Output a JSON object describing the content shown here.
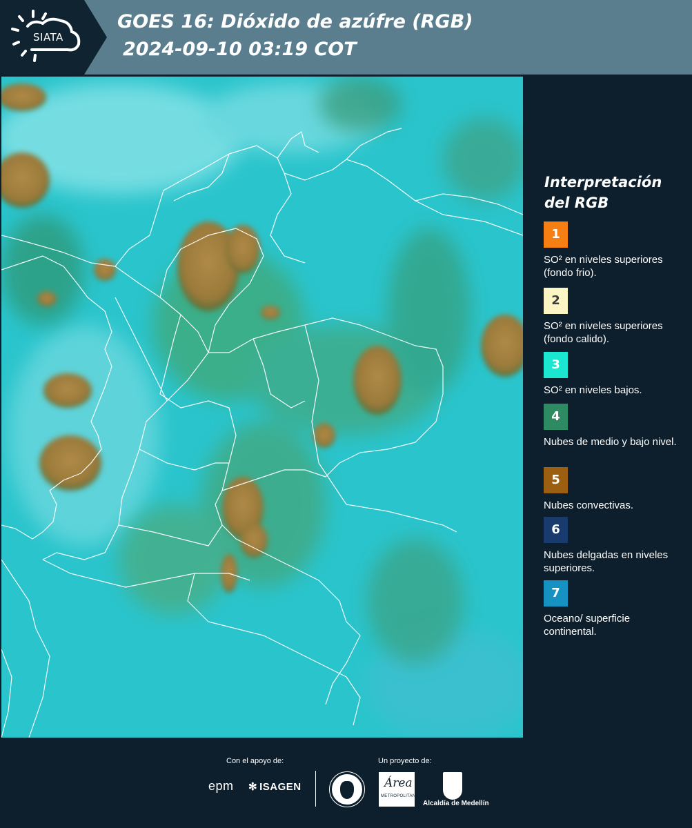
{
  "header": {
    "logo_text": "SIATA",
    "title_line1": "GOES 16: Dióxido de azúfre (RGB)",
    "title_line2": "2024-09-10 03:19 COT"
  },
  "legend": {
    "title_line1": "Interpretación",
    "title_line2": "del RGB",
    "items": [
      {
        "number": "1",
        "color": "#f57f12",
        "text_color": "#ffffff",
        "label": "SO² en niveles superiores (fondo frio)."
      },
      {
        "number": "2",
        "color": "#fbf4c3",
        "text_color": "#3b3b3b",
        "label": "SO² en niveles superiores (fondo calido)."
      },
      {
        "number": "3",
        "color": "#1be7d0",
        "text_color": "#ffffff",
        "label": "SO² en niveles bajos."
      },
      {
        "number": "4",
        "color": "#2d8a63",
        "text_color": "#ffffff",
        "label": "Nubes de medio y bajo nivel."
      },
      {
        "number": "5",
        "color": "#9c5e10",
        "text_color": "#ffffff",
        "label": "Nubes convectivas."
      },
      {
        "number": "6",
        "color": "#183a6c",
        "text_color": "#ffffff",
        "label": "Nubes delgadas en niveles superiores."
      },
      {
        "number": "7",
        "color": "#1692c2",
        "text_color": "#ffffff",
        "label": "Oceano/ superficie continental."
      }
    ]
  },
  "footer": {
    "support_label": "Con el apoyo de:",
    "project_label": "Un proyecto de:",
    "epm_logo": "epm",
    "isagen_logo": "ISAGEN",
    "area_logo": "Área",
    "area_sub": "METROPOLITANA",
    "alcaldia_logo": "Alcaldía de Medellín"
  },
  "map": {
    "ocean_color": "#23c3cc",
    "convective_color": "#9a7a3a",
    "border_color": "#ffffff"
  }
}
